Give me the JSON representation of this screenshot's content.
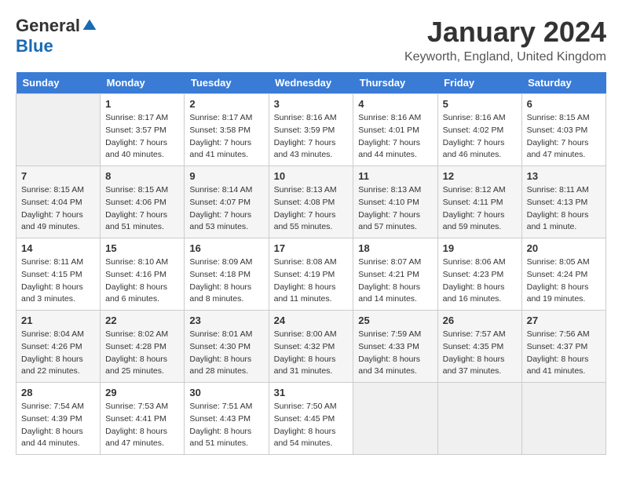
{
  "logo": {
    "general": "General",
    "blue": "Blue"
  },
  "title": "January 2024",
  "location": "Keyworth, England, United Kingdom",
  "days_of_week": [
    "Sunday",
    "Monday",
    "Tuesday",
    "Wednesday",
    "Thursday",
    "Friday",
    "Saturday"
  ],
  "weeks": [
    [
      {
        "day": "",
        "sunrise": "",
        "sunset": "",
        "daylight": ""
      },
      {
        "day": "1",
        "sunrise": "Sunrise: 8:17 AM",
        "sunset": "Sunset: 3:57 PM",
        "daylight": "Daylight: 7 hours and 40 minutes."
      },
      {
        "day": "2",
        "sunrise": "Sunrise: 8:17 AM",
        "sunset": "Sunset: 3:58 PM",
        "daylight": "Daylight: 7 hours and 41 minutes."
      },
      {
        "day": "3",
        "sunrise": "Sunrise: 8:16 AM",
        "sunset": "Sunset: 3:59 PM",
        "daylight": "Daylight: 7 hours and 43 minutes."
      },
      {
        "day": "4",
        "sunrise": "Sunrise: 8:16 AM",
        "sunset": "Sunset: 4:01 PM",
        "daylight": "Daylight: 7 hours and 44 minutes."
      },
      {
        "day": "5",
        "sunrise": "Sunrise: 8:16 AM",
        "sunset": "Sunset: 4:02 PM",
        "daylight": "Daylight: 7 hours and 46 minutes."
      },
      {
        "day": "6",
        "sunrise": "Sunrise: 8:15 AM",
        "sunset": "Sunset: 4:03 PM",
        "daylight": "Daylight: 7 hours and 47 minutes."
      }
    ],
    [
      {
        "day": "7",
        "sunrise": "Sunrise: 8:15 AM",
        "sunset": "Sunset: 4:04 PM",
        "daylight": "Daylight: 7 hours and 49 minutes."
      },
      {
        "day": "8",
        "sunrise": "Sunrise: 8:15 AM",
        "sunset": "Sunset: 4:06 PM",
        "daylight": "Daylight: 7 hours and 51 minutes."
      },
      {
        "day": "9",
        "sunrise": "Sunrise: 8:14 AM",
        "sunset": "Sunset: 4:07 PM",
        "daylight": "Daylight: 7 hours and 53 minutes."
      },
      {
        "day": "10",
        "sunrise": "Sunrise: 8:13 AM",
        "sunset": "Sunset: 4:08 PM",
        "daylight": "Daylight: 7 hours and 55 minutes."
      },
      {
        "day": "11",
        "sunrise": "Sunrise: 8:13 AM",
        "sunset": "Sunset: 4:10 PM",
        "daylight": "Daylight: 7 hours and 57 minutes."
      },
      {
        "day": "12",
        "sunrise": "Sunrise: 8:12 AM",
        "sunset": "Sunset: 4:11 PM",
        "daylight": "Daylight: 7 hours and 59 minutes."
      },
      {
        "day": "13",
        "sunrise": "Sunrise: 8:11 AM",
        "sunset": "Sunset: 4:13 PM",
        "daylight": "Daylight: 8 hours and 1 minute."
      }
    ],
    [
      {
        "day": "14",
        "sunrise": "Sunrise: 8:11 AM",
        "sunset": "Sunset: 4:15 PM",
        "daylight": "Daylight: 8 hours and 3 minutes."
      },
      {
        "day": "15",
        "sunrise": "Sunrise: 8:10 AM",
        "sunset": "Sunset: 4:16 PM",
        "daylight": "Daylight: 8 hours and 6 minutes."
      },
      {
        "day": "16",
        "sunrise": "Sunrise: 8:09 AM",
        "sunset": "Sunset: 4:18 PM",
        "daylight": "Daylight: 8 hours and 8 minutes."
      },
      {
        "day": "17",
        "sunrise": "Sunrise: 8:08 AM",
        "sunset": "Sunset: 4:19 PM",
        "daylight": "Daylight: 8 hours and 11 minutes."
      },
      {
        "day": "18",
        "sunrise": "Sunrise: 8:07 AM",
        "sunset": "Sunset: 4:21 PM",
        "daylight": "Daylight: 8 hours and 14 minutes."
      },
      {
        "day": "19",
        "sunrise": "Sunrise: 8:06 AM",
        "sunset": "Sunset: 4:23 PM",
        "daylight": "Daylight: 8 hours and 16 minutes."
      },
      {
        "day": "20",
        "sunrise": "Sunrise: 8:05 AM",
        "sunset": "Sunset: 4:24 PM",
        "daylight": "Daylight: 8 hours and 19 minutes."
      }
    ],
    [
      {
        "day": "21",
        "sunrise": "Sunrise: 8:04 AM",
        "sunset": "Sunset: 4:26 PM",
        "daylight": "Daylight: 8 hours and 22 minutes."
      },
      {
        "day": "22",
        "sunrise": "Sunrise: 8:02 AM",
        "sunset": "Sunset: 4:28 PM",
        "daylight": "Daylight: 8 hours and 25 minutes."
      },
      {
        "day": "23",
        "sunrise": "Sunrise: 8:01 AM",
        "sunset": "Sunset: 4:30 PM",
        "daylight": "Daylight: 8 hours and 28 minutes."
      },
      {
        "day": "24",
        "sunrise": "Sunrise: 8:00 AM",
        "sunset": "Sunset: 4:32 PM",
        "daylight": "Daylight: 8 hours and 31 minutes."
      },
      {
        "day": "25",
        "sunrise": "Sunrise: 7:59 AM",
        "sunset": "Sunset: 4:33 PM",
        "daylight": "Daylight: 8 hours and 34 minutes."
      },
      {
        "day": "26",
        "sunrise": "Sunrise: 7:57 AM",
        "sunset": "Sunset: 4:35 PM",
        "daylight": "Daylight: 8 hours and 37 minutes."
      },
      {
        "day": "27",
        "sunrise": "Sunrise: 7:56 AM",
        "sunset": "Sunset: 4:37 PM",
        "daylight": "Daylight: 8 hours and 41 minutes."
      }
    ],
    [
      {
        "day": "28",
        "sunrise": "Sunrise: 7:54 AM",
        "sunset": "Sunset: 4:39 PM",
        "daylight": "Daylight: 8 hours and 44 minutes."
      },
      {
        "day": "29",
        "sunrise": "Sunrise: 7:53 AM",
        "sunset": "Sunset: 4:41 PM",
        "daylight": "Daylight: 8 hours and 47 minutes."
      },
      {
        "day": "30",
        "sunrise": "Sunrise: 7:51 AM",
        "sunset": "Sunset: 4:43 PM",
        "daylight": "Daylight: 8 hours and 51 minutes."
      },
      {
        "day": "31",
        "sunrise": "Sunrise: 7:50 AM",
        "sunset": "Sunset: 4:45 PM",
        "daylight": "Daylight: 8 hours and 54 minutes."
      },
      {
        "day": "",
        "sunrise": "",
        "sunset": "",
        "daylight": ""
      },
      {
        "day": "",
        "sunrise": "",
        "sunset": "",
        "daylight": ""
      },
      {
        "day": "",
        "sunrise": "",
        "sunset": "",
        "daylight": ""
      }
    ]
  ]
}
